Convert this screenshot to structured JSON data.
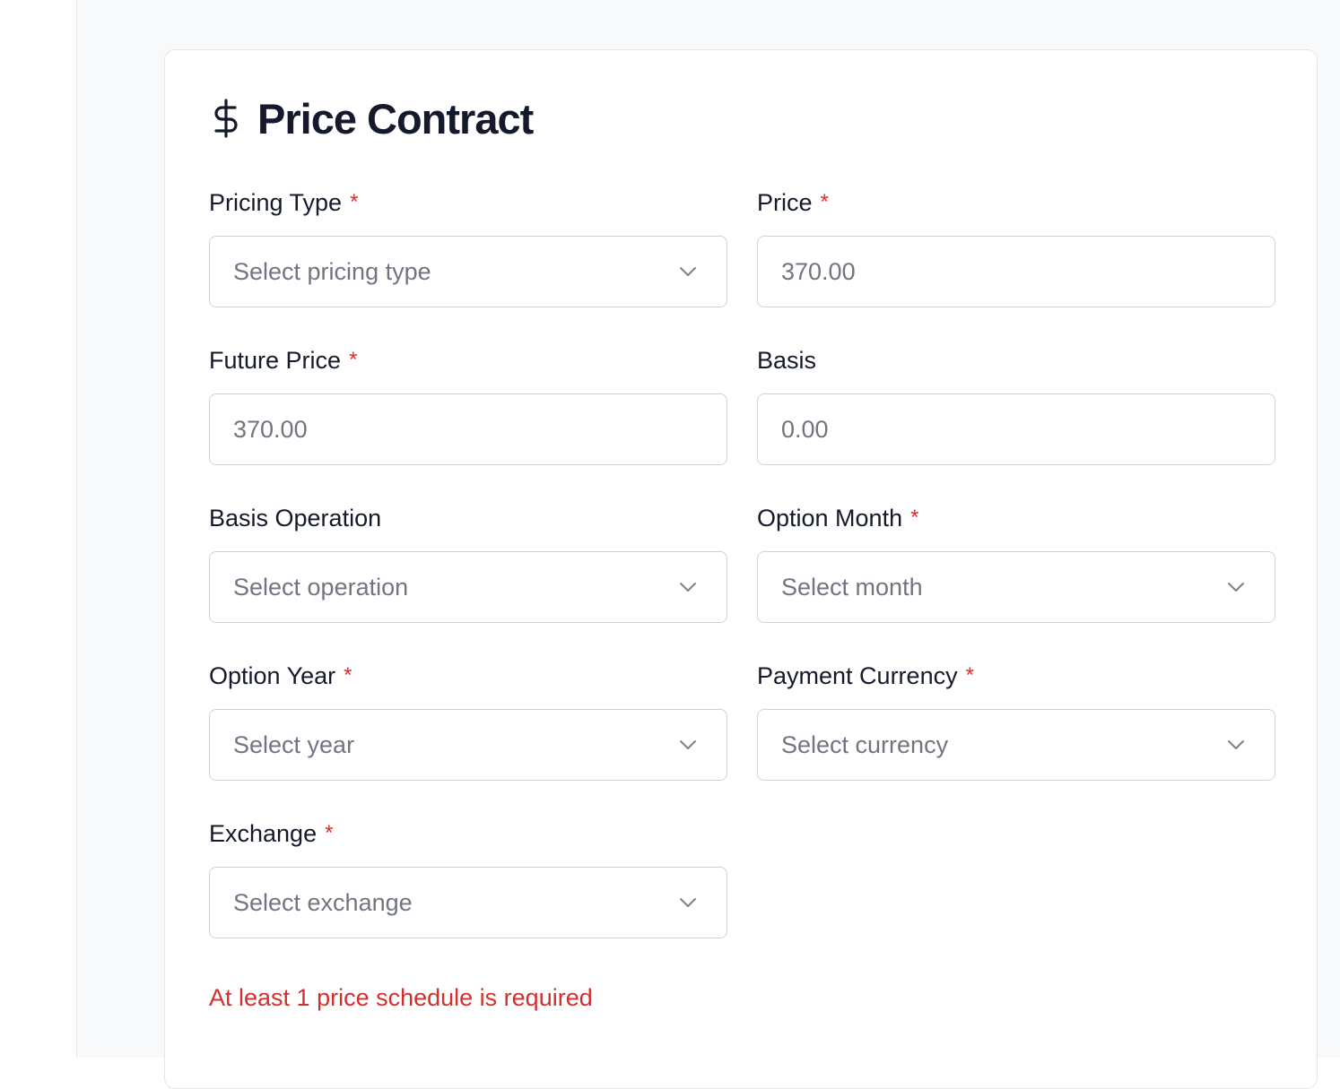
{
  "header": {
    "icon": "dollar-icon",
    "title": "Price Contract"
  },
  "fields": {
    "pricing_type": {
      "label": "Pricing Type",
      "required": true,
      "placeholder": "Select pricing type",
      "kind": "select"
    },
    "price": {
      "label": "Price",
      "required": true,
      "placeholder": "370.00",
      "kind": "input"
    },
    "future_price": {
      "label": "Future Price",
      "required": true,
      "placeholder": "370.00",
      "kind": "input"
    },
    "basis": {
      "label": "Basis",
      "required": false,
      "placeholder": "0.00",
      "kind": "input"
    },
    "basis_operation": {
      "label": "Basis Operation",
      "required": false,
      "placeholder": "Select operation",
      "kind": "select"
    },
    "option_month": {
      "label": "Option Month",
      "required": true,
      "placeholder": "Select month",
      "kind": "select"
    },
    "option_year": {
      "label": "Option Year",
      "required": true,
      "placeholder": "Select year",
      "kind": "select"
    },
    "payment_currency": {
      "label": "Payment Currency",
      "required": true,
      "placeholder": "Select currency",
      "kind": "select"
    },
    "exchange": {
      "label": "Exchange",
      "required": true,
      "placeholder": "Select exchange",
      "kind": "select"
    }
  },
  "required_marker": "*",
  "error": "At least 1 price schedule is required",
  "colors": {
    "title": "#141a2b",
    "required": "#dc2f2f",
    "error": "#d22f2f",
    "placeholder": "#707580",
    "border": "#cfd3d9"
  }
}
